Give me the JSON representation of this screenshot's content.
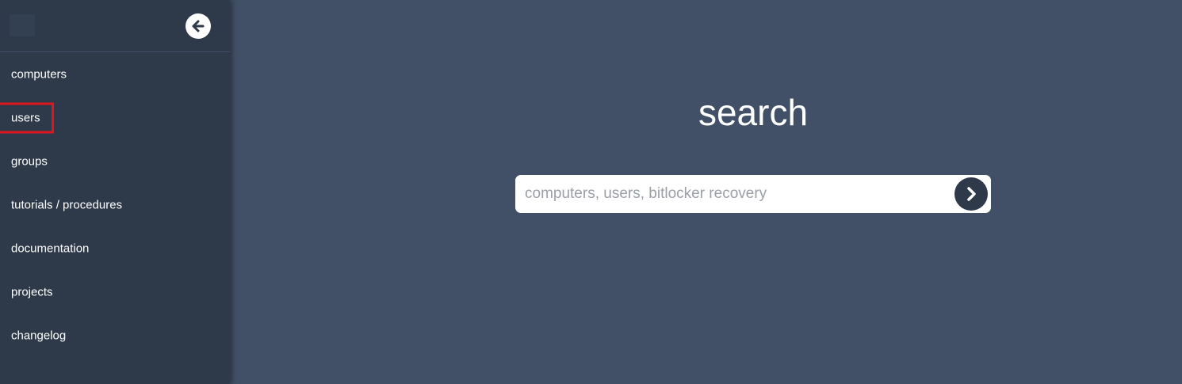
{
  "sidebar": {
    "collapse_icon": "arrow-left-icon",
    "items": [
      {
        "label": "computers"
      },
      {
        "label": "users"
      },
      {
        "label": "groups"
      },
      {
        "label": "tutorials / procedures"
      },
      {
        "label": "documentation"
      },
      {
        "label": "projects"
      },
      {
        "label": "changelog"
      }
    ]
  },
  "main": {
    "title": "search",
    "search": {
      "placeholder": "computers, users, bitlocker recovery",
      "value": "",
      "submit_icon": "chevron-right-icon"
    }
  },
  "colors": {
    "page_bg": "#415067",
    "sidebar_bg": "#2e3a4a",
    "highlight": "#e0161f"
  }
}
